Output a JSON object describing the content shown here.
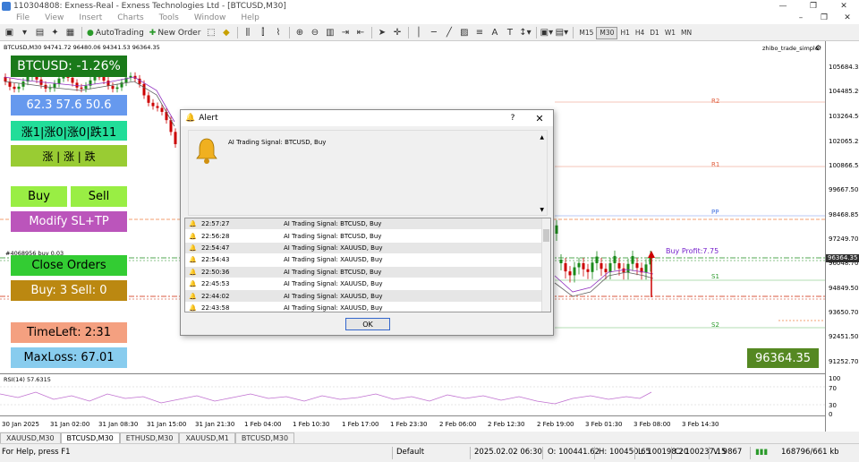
{
  "window": {
    "title": "110304808: Exness-Real - Exness Technologies Ltd - [BTCUSD,M30]"
  },
  "menu": [
    "File",
    "View",
    "Insert",
    "Charts",
    "Tools",
    "Window",
    "Help"
  ],
  "toolbar": {
    "autotrading": "AutoTrading",
    "new_order": "New Order",
    "timeframes": [
      "M15",
      "M30",
      "H1",
      "H4",
      "D1",
      "W1",
      "MN"
    ],
    "selected_tf": "M30"
  },
  "chart": {
    "symbol_header": "BTCUSD,M30  94741.72 96480.06 94341.53 96364.35",
    "indicator_name": "zhibo_trade_simple",
    "order_line_label": "#4068956 buy 0.03",
    "overlay": {
      "change": "BTCUSD: -1.26%",
      "rsi_values": "62.3  57.6  50.6",
      "trend_row1": "涨1|涨0|涨0|跌11",
      "trend_row2": "涨 | 涨 | 跌",
      "buy": "Buy",
      "sell": "Sell",
      "modify": "Modify SL+TP",
      "close": "Close Orders",
      "counts": "Buy: 3  Sell: 0",
      "timeleft": "TimeLeft: 2:31",
      "maxloss": "MaxLoss: 67.01",
      "price_big": "96364.35",
      "buy_profit": "Buy Profit:7.75"
    },
    "pivots": {
      "r2": "R2",
      "r1": "R1",
      "pp": "PP",
      "s1": "S1",
      "s2": "S2"
    },
    "price_axis": [
      "105684.35",
      "104485.20",
      "103264.50",
      "102065.25",
      "100866.55",
      "99667.50",
      "98468.85",
      "97249.70",
      "96048.70",
      "94849.50",
      "93650.70",
      "92451.50",
      "91252.70"
    ],
    "price_current": "96364.35",
    "rsi_label": "RSI(14) 57.6315",
    "rsi_axis": [
      "100",
      "70",
      "30",
      "0"
    ],
    "time_axis": [
      "30 Jan 2025",
      "31 Jan 02:00",
      "31 Jan 08:30",
      "31 Jan 15:00",
      "31 Jan 21:30",
      "1 Feb 04:00",
      "1 Feb 10:30",
      "1 Feb 17:00",
      "1 Feb 23:30",
      "2 Feb 06:00",
      "2 Feb 12:30",
      "2 Feb 19:00",
      "3 Feb 01:30",
      "3 Feb 08:00",
      "3 Feb 14:30"
    ]
  },
  "alert": {
    "title": "Alert",
    "help": "?",
    "close": "✕",
    "message": "AI Trading Signal: BTCUSD, Buy",
    "ok": "OK",
    "rows": [
      {
        "time": "22:57:27",
        "msg": "AI Trading Signal: BTCUSD, Buy"
      },
      {
        "time": "22:56:28",
        "msg": "AI Trading Signal: BTCUSD, Buy"
      },
      {
        "time": "22:54:47",
        "msg": "AI Trading Signal: XAUUSD, Buy"
      },
      {
        "time": "22:54:43",
        "msg": "AI Trading Signal: XAUUSD, Buy"
      },
      {
        "time": "22:50:36",
        "msg": "AI Trading Signal: BTCUSD, Buy"
      },
      {
        "time": "22:45:53",
        "msg": "AI Trading Signal: XAUUSD, Buy"
      },
      {
        "time": "22:44:02",
        "msg": "AI Trading Signal: XAUUSD, Buy"
      },
      {
        "time": "22:43:58",
        "msg": "AI Trading Signal: XAUUSD, Buy"
      }
    ]
  },
  "tabs": [
    {
      "label": "XAUUSD,M30",
      "active": false
    },
    {
      "label": "BTCUSD,M30",
      "active": true
    },
    {
      "label": "ETHUSD,M30",
      "active": false
    },
    {
      "label": "XAUUSD,M1",
      "active": false
    },
    {
      "label": "BTCUSD,M30",
      "active": false
    }
  ],
  "status": {
    "help": "For Help, press F1",
    "profile": "Default",
    "datetime": "2025.02.02 06:30",
    "open": "O: 100441.62",
    "high": "H: 100450.65",
    "low": "L: 100198.20",
    "close": "C: 100237.15",
    "volume": "V: 9867",
    "traffic": "168796/661 kb"
  },
  "colors": {
    "up": "#1a8a1a",
    "down": "#cc0000",
    "accent": "#3366cc"
  }
}
